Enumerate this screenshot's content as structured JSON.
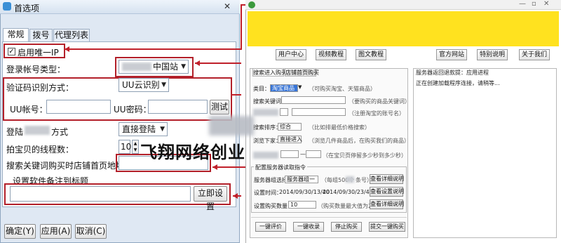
{
  "dialog": {
    "title": "首选项",
    "close_glyph": "✕",
    "tabs": [
      "常规",
      "拨号",
      "代理列表"
    ],
    "unique_ip": {
      "label": "启用唯一IP",
      "checked": true,
      "check_glyph": "✓"
    },
    "login_type": {
      "label": "登录帐号类型：",
      "value": "中国站"
    },
    "captcha": {
      "label": "验证码识别方式：",
      "value": "UU云识别",
      "account_label": "UU帐号：",
      "password_label": "UU密码：",
      "test_button": "测试"
    },
    "login_method": {
      "label_prefix": "登陆",
      "label_suffix": "方式",
      "value": "直接登陆"
    },
    "threads": {
      "label": "拍宝贝的线程数：",
      "value": "10"
    },
    "shop_url_label": "搜索关键词购买时店铺首页地址：",
    "remark": {
      "label": "设置软件备注到标题",
      "apply_button": "立即设置"
    },
    "buttons": {
      "ok": "确定(Y)",
      "apply": "应用(A)",
      "cancel": "取消(C)"
    },
    "combo_arrow": "▼"
  },
  "annotation_text": "飞翔网络创业",
  "app": {
    "window_controls": [
      "—",
      "▫",
      "✕"
    ],
    "nav_left": [
      "用户中心",
      "视频教程",
      "图文教程"
    ],
    "nav_right": [
      "官方网站",
      "特别说明",
      "关于我们"
    ],
    "tabs": [
      "搜索进入购买",
      "店铺首页购买"
    ],
    "rows": {
      "category_label": "类目：",
      "category_value": "淘宝商品",
      "category_hint": "（可购买淘宝、天猫商品）",
      "keyword_label": "搜索关键词：",
      "keyword_hint": "（要购买的商品关键词）",
      "wangwang_hint": "（注册淘宝的账号名）",
      "sort_label": "搜索排序：",
      "sort_value": "综合",
      "sort_hint": "（比如排最低价格搜索）",
      "browse_label": "浏览下家：",
      "browse_value": "直接进入",
      "browse_hint": "（浏览几件商品后，在购买我们的商品）",
      "dash": "—",
      "stay_hint": "（在宝贝页停留多少秒到多少秒）"
    },
    "server_group": {
      "title": "配置服务器读取指令",
      "server_select_label": "服务器组选择：",
      "server_select_value": "服务器组一",
      "server_hint": "（每组500个",
      "server_hint_tail": "条号）",
      "view_detail": "查看详细说明",
      "time_label": "设置时间：",
      "time_from": "2014/09/30/13/40",
      "time_to": "2014/09/30/23/40",
      "view_settings": "查看设置说明",
      "qty_label": "设置购买数量：",
      "qty_value": "10",
      "qty_hint": "（购买数量最大值为200）"
    },
    "bottom_buttons": [
      "一键评价",
      "一键收录",
      "停止购买",
      "提交一键购买"
    ],
    "right_panel": {
      "title": "服务器返回退款提：应用进程",
      "status": "正在创建加载程序连接，请稍等..."
    }
  }
}
